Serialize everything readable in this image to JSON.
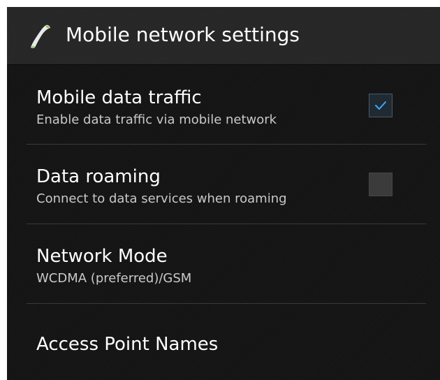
{
  "action_bar": {
    "title": "Mobile network settings",
    "icon": "phone-handset-icon"
  },
  "settings": [
    {
      "title": "Mobile data traffic",
      "summary": "Enable data traffic via mobile network",
      "control": "checkbox",
      "checked": true
    },
    {
      "title": "Data roaming",
      "summary": "Connect to data services when roaming",
      "control": "checkbox",
      "checked": false
    },
    {
      "title": "Network Mode",
      "summary": "WCDMA (preferred)/GSM"
    },
    {
      "title": "Access Point Names"
    }
  ],
  "colors": {
    "checkmark": "#3fa9f5",
    "background": "#141414",
    "action_bar": "#262626",
    "title_text": "#ffffff",
    "summary_text": "#c9c9c9"
  }
}
